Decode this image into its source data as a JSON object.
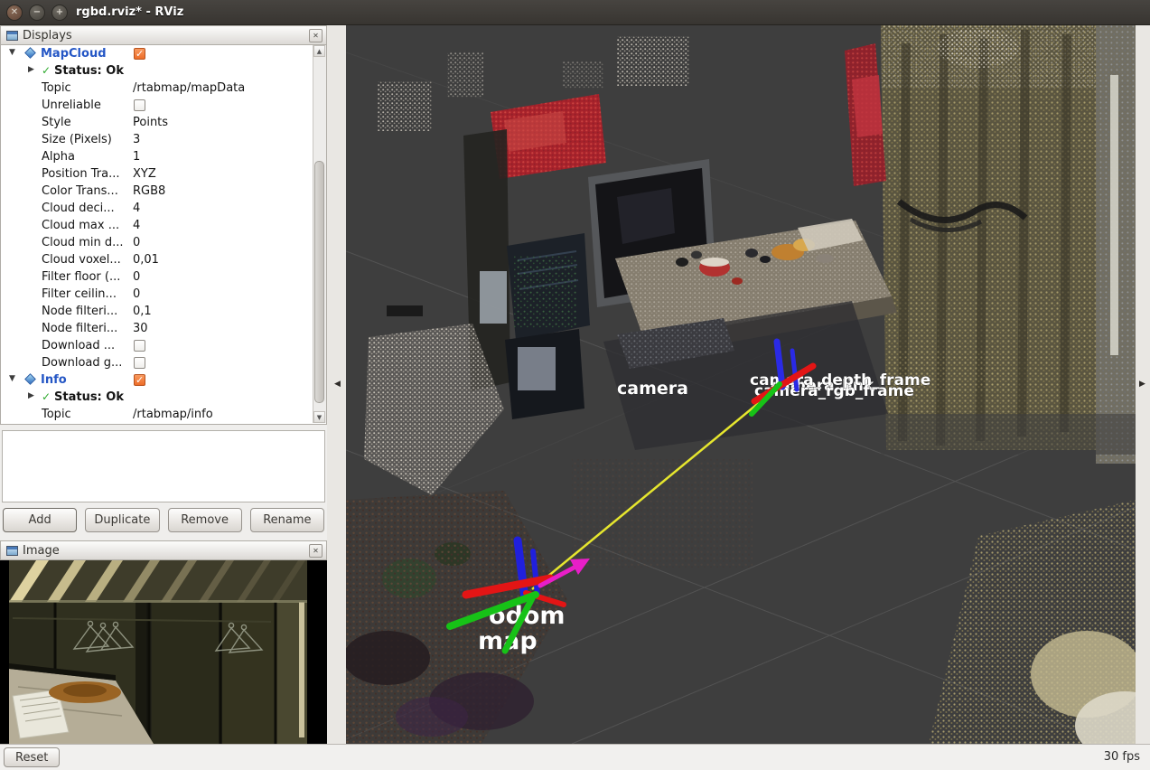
{
  "window": {
    "title": "rgbd.rviz* - RViz"
  },
  "icons": {
    "expand_open": "▼",
    "expand_closed": "▶",
    "check": "✓",
    "close": "✕",
    "scroll_up": "▲",
    "scroll_down": "▼",
    "splitter_left": "◀",
    "splitter_right": "▶",
    "win_close": "✕",
    "win_min": "−",
    "win_max": "+"
  },
  "displays": {
    "title": "Displays",
    "rows": [
      {
        "label": "MapCloud",
        "checked": true
      },
      {
        "label": "Status: Ok"
      },
      {
        "key": "Topic",
        "value": "/rtabmap/mapData"
      },
      {
        "key": "Unreliable",
        "checked": false
      },
      {
        "key": "Style",
        "value": "Points"
      },
      {
        "key": "Size (Pixels)",
        "value": "3"
      },
      {
        "key": "Alpha",
        "value": "1"
      },
      {
        "key": "Position Tra...",
        "value": "XYZ"
      },
      {
        "key": "Color Trans...",
        "value": "RGB8"
      },
      {
        "key": "Cloud deci...",
        "value": "4"
      },
      {
        "key": "Cloud max ...",
        "value": "4"
      },
      {
        "key": "Cloud min d...",
        "value": "0"
      },
      {
        "key": "Cloud voxel...",
        "value": "0,01"
      },
      {
        "key": "Filter floor (...",
        "value": "0"
      },
      {
        "key": "Filter ceilin...",
        "value": "0"
      },
      {
        "key": "Node filteri...",
        "value": "0,1"
      },
      {
        "key": "Node filteri...",
        "value": "30"
      },
      {
        "key": "Download ...",
        "checked": false
      },
      {
        "key": "Download g...",
        "checked": false
      },
      {
        "label": "Info",
        "checked": true
      },
      {
        "label": "Status: Ok"
      },
      {
        "key": "Topic",
        "value": "/rtabmap/info"
      }
    ],
    "buttons": {
      "add": "Add",
      "duplicate": "Duplicate",
      "remove": "Remove",
      "rename": "Rename"
    }
  },
  "image_panel": {
    "title": "Image"
  },
  "view3d": {
    "labels": {
      "odom": "odom",
      "map": "map",
      "camera": "camera"
    },
    "frame_labels": [
      "camera_link",
      "camera_rgb_frame",
      "camera_depth_frame"
    ]
  },
  "colors": {
    "axis_x": "#e31515",
    "axis_y": "#17c217",
    "axis_z": "#2020dd",
    "tf_link": "#e6e62e",
    "map_arrow": "#e81ec8",
    "enabled_checkbox": "#ee6d28",
    "display_name": "#2456c5",
    "status_ok": "#2faa2f",
    "viewport_bg": "#3e3e3e"
  },
  "statusbar": {
    "reset": "Reset",
    "fps": "30 fps"
  }
}
